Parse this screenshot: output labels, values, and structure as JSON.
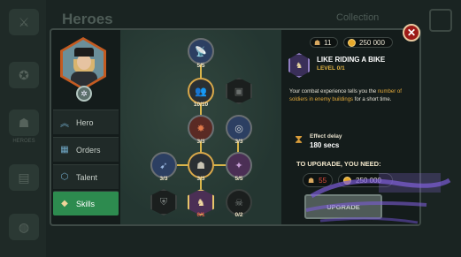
{
  "background": {
    "title": "Heroes",
    "collection_label": "Collection",
    "sidebar": [
      {
        "label": "",
        "icon": "crossed-swords-icon"
      },
      {
        "label": "",
        "icon": "medal-icon"
      },
      {
        "label": "HEROES",
        "icon": "soldier-icon"
      },
      {
        "label": "",
        "icon": "cards-icon"
      },
      {
        "label": "",
        "icon": "bag-icon"
      }
    ]
  },
  "tabs": [
    {
      "label": "Hero",
      "icon": "chevrons-icon",
      "active": false
    },
    {
      "label": "Orders",
      "icon": "cards-icon",
      "active": false
    },
    {
      "label": "Talent",
      "icon": "hexagon-icon",
      "active": false
    },
    {
      "label": "Skills",
      "icon": "skills-icon",
      "active": true
    }
  ],
  "tree": {
    "nodes": [
      {
        "id": "n1",
        "count": "5/5",
        "style": "blue",
        "icon": "radar-icon"
      },
      {
        "id": "n2",
        "count": "10/10",
        "style": "gold",
        "icon": "soldiers-icon"
      },
      {
        "id": "n3",
        "count": "",
        "style": "dim",
        "icon": "locked-icon"
      },
      {
        "id": "n4",
        "count": "3/3",
        "style": "red",
        "icon": "explosion-icon"
      },
      {
        "id": "n5",
        "count": "3/3",
        "style": "blue",
        "icon": "target-icon"
      },
      {
        "id": "n6",
        "count": "3/3",
        "style": "blue",
        "icon": "missile-icon"
      },
      {
        "id": "n7",
        "count": "3/3",
        "style": "gold",
        "icon": "soldier-icon"
      },
      {
        "id": "n8",
        "count": "5/5",
        "style": "purple",
        "icon": "grenade-icon"
      },
      {
        "id": "n9",
        "count": "",
        "style": "dim",
        "icon": "shield-icon"
      },
      {
        "id": "n10",
        "count": "0/1",
        "style": "purple",
        "icon": "bike-icon"
      },
      {
        "id": "n11",
        "count": "0/2",
        "style": "dim",
        "icon": "mask-icon"
      }
    ]
  },
  "resources": {
    "tokens": "11",
    "gold": "250 000"
  },
  "skill": {
    "name": "LIKE RIDING A BIKE",
    "level_label": "LEVEL",
    "level_value": "0/1",
    "desc_pre": "Your combat experience tells you the ",
    "desc_hl": "number of soldiers in enemy buildings",
    "desc_post": " for a short time.",
    "effect_label": "Effect delay",
    "effect_value": "180 secs"
  },
  "upgrade": {
    "title": "TO UPGRADE, YOU NEED:",
    "cost_tokens": "55",
    "cost_gold": "250 000",
    "button_label": "UPGRADE"
  },
  "colors": {
    "accent_green": "#2d8b4f",
    "gold": "#d9b54a",
    "close_red": "#9c1a17"
  }
}
